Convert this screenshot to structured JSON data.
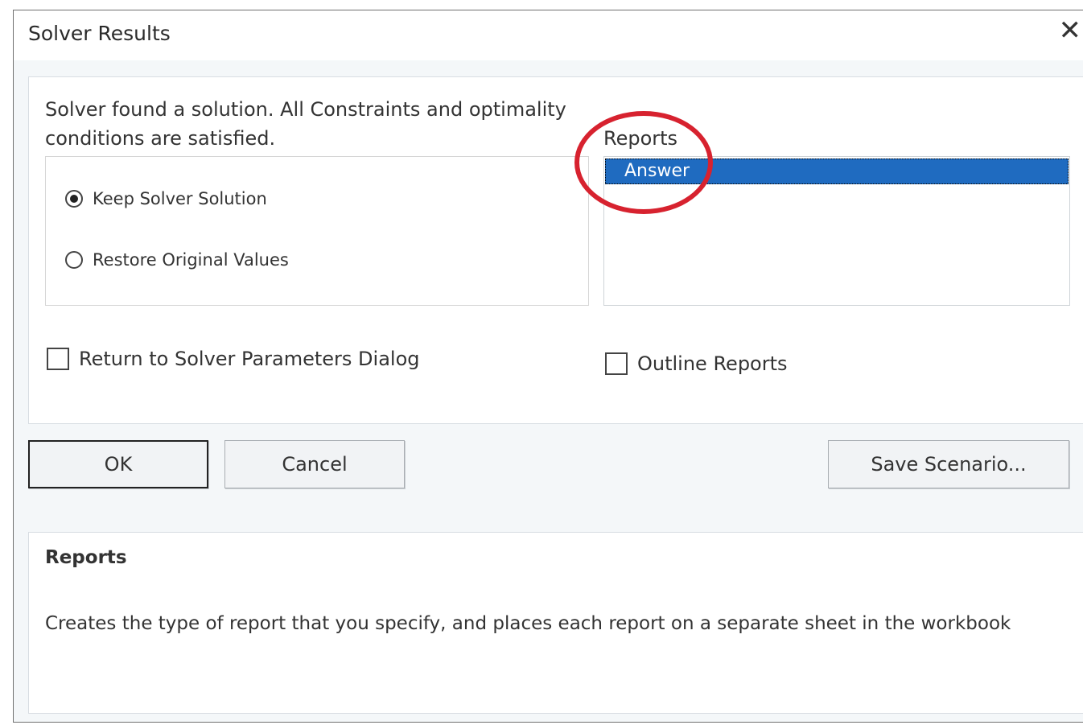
{
  "dialog": {
    "title": "Solver Results",
    "close_glyph": "✕"
  },
  "message": "Solver found a solution.  All Constraints and optimality conditions are satisfied.",
  "options": {
    "keep": {
      "label": "Keep Solver Solution",
      "selected": true
    },
    "restore": {
      "label": "Restore Original Values",
      "selected": false
    }
  },
  "reports": {
    "label": "Reports",
    "items": [
      {
        "label": "Answer",
        "selected": true
      }
    ],
    "highlight_color": "#d7222f"
  },
  "checkboxes": {
    "return_dialog": {
      "label": "Return to Solver Parameters Dialog",
      "checked": false
    },
    "outline_reports": {
      "label": "Outline Reports",
      "checked": false
    }
  },
  "buttons": {
    "ok": "OK",
    "cancel": "Cancel",
    "save_scenario": "Save Scenario..."
  },
  "help": {
    "title": "Reports",
    "text": "Creates the type of report that you specify, and places each report on a separate sheet in the workbook"
  },
  "colors": {
    "selection": "#1f6bc0",
    "annotation_circle": "#d7222f"
  }
}
